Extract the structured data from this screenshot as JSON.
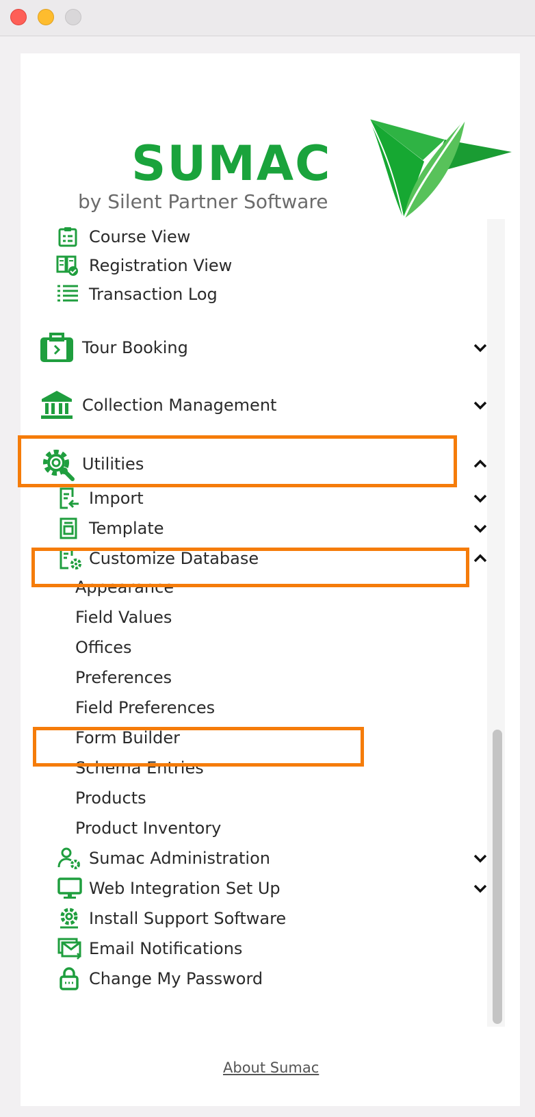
{
  "logo": {
    "wordmark": "SUMAC",
    "tagline": "by Silent Partner Software",
    "brand_color": "#1aa33c"
  },
  "nav": {
    "course_view": "Course View",
    "registration_view": "Registration View",
    "transaction_log": "Transaction Log",
    "tour_booking": "Tour Booking",
    "collection_management": "Collection Management",
    "utilities": "Utilities",
    "import": "Import",
    "template": "Template",
    "customize_database": "Customize Database",
    "customize_items": {
      "appearance": "Appearance",
      "field_values": "Field Values",
      "offices": "Offices",
      "preferences": "Preferences",
      "field_preferences": "Field Preferences",
      "form_builder": "Form Builder",
      "schema_entries": "Schema Entries",
      "products": "Products",
      "product_inventory": "Product Inventory"
    },
    "sumac_administration": "Sumac Administration",
    "web_integration": "Web Integration Set Up",
    "install_support": "Install Support Software",
    "email_notifications": "Email Notifications",
    "change_password": "Change My Password"
  },
  "footer": {
    "about": "About Sumac"
  },
  "colors": {
    "icon_green": "#1f9e3e",
    "highlight_orange": "#f57c0a"
  }
}
